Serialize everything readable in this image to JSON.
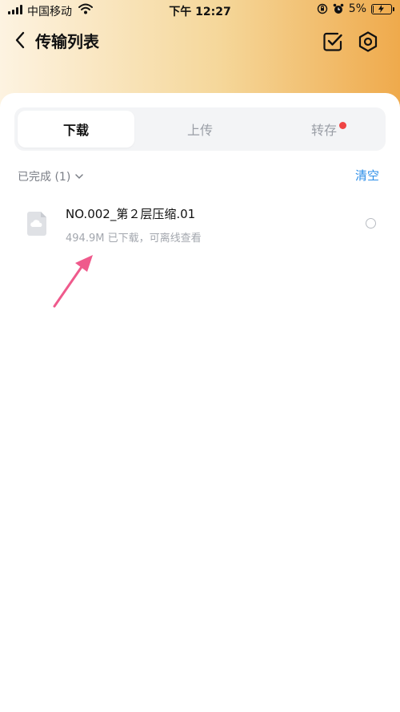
{
  "status_bar": {
    "carrier": "中国移动",
    "time": "下午 12:27",
    "battery_percent": "5%",
    "battery_level": 0.05,
    "icons": [
      "signal-icon",
      "wifi-icon",
      "rotation-lock-icon",
      "alarm-icon",
      "battery-icon"
    ]
  },
  "nav": {
    "title": "传输列表",
    "icons": [
      "back-chevron-icon",
      "checkbox-check-icon",
      "gear-icon"
    ]
  },
  "tabs": [
    {
      "label": "下载",
      "active": true
    },
    {
      "label": "上传",
      "active": false
    },
    {
      "label": "转存",
      "active": false,
      "has_badge": true
    }
  ],
  "section": {
    "label": "已完成 (1)",
    "clear_label": "清空"
  },
  "files": [
    {
      "name": "NO.002_第２层压缩.01",
      "meta": "494.9M  已下载，可离线查看",
      "icon": "cloud-file-icon"
    }
  ],
  "colors": {
    "accent_blue": "#2b8ee8",
    "badge_red": "#ef4444",
    "arrow_pink": "#ef5a8c",
    "header_gradient_start": "#fdf3e1",
    "header_gradient_end": "#efaa4c"
  }
}
